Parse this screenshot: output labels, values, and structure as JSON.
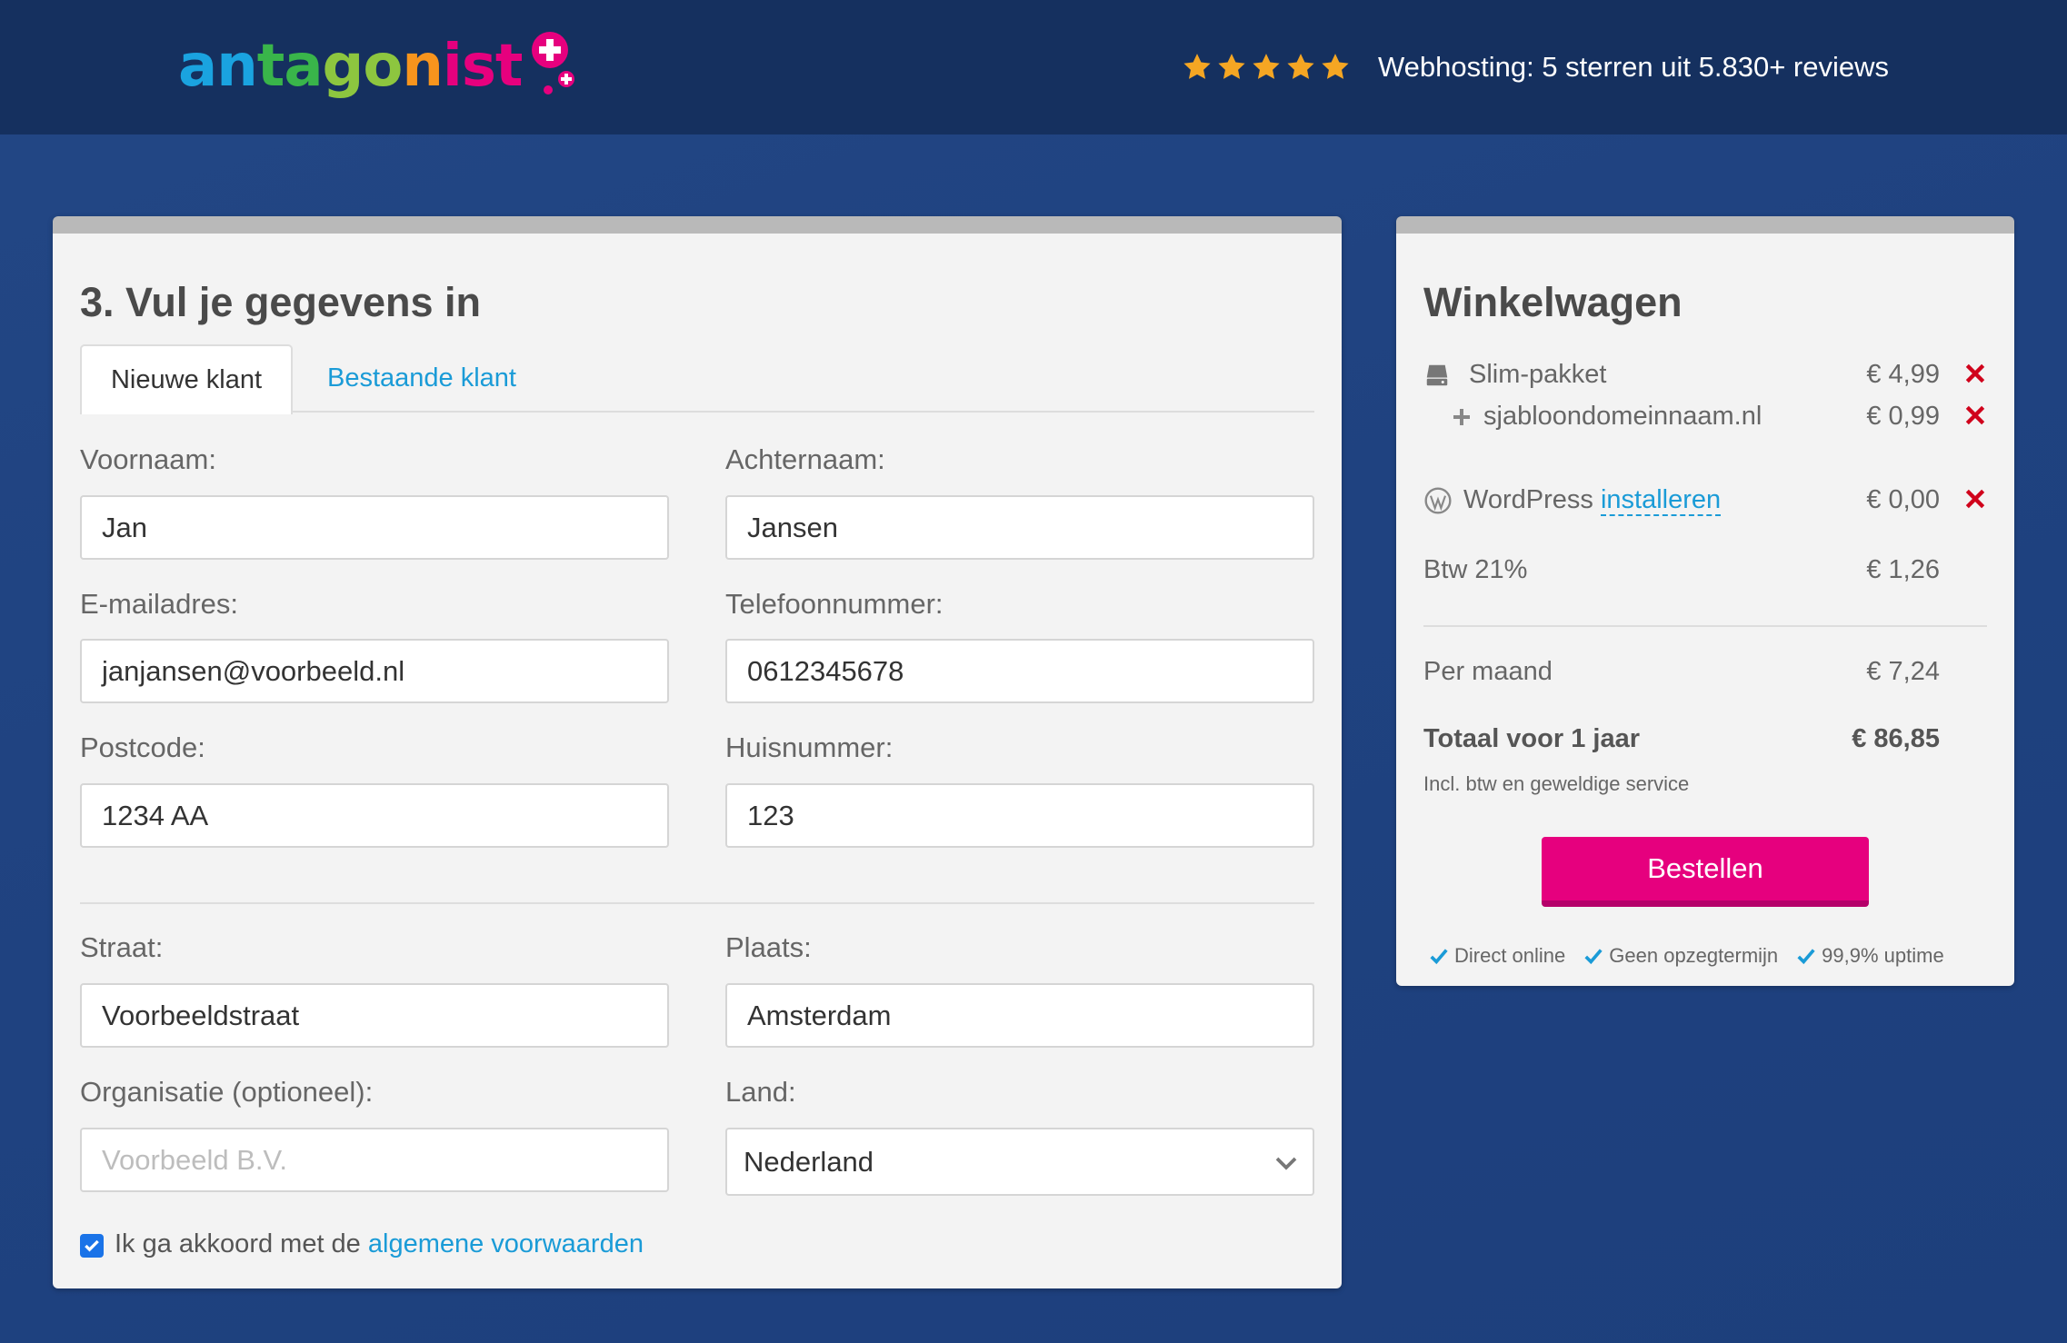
{
  "header": {
    "logo_text": "antagonist",
    "rating_text": "Webhosting: 5 sterren uit 5.830+ reviews",
    "stars": 5
  },
  "form": {
    "title": "3. Vul je gegevens in",
    "tabs": [
      {
        "label": "Nieuwe klant",
        "active": true
      },
      {
        "label": "Bestaande klant",
        "active": false
      }
    ],
    "fields": {
      "first_name": {
        "label": "Voornaam:",
        "value": "Jan"
      },
      "last_name": {
        "label": "Achternaam:",
        "value": "Jansen"
      },
      "email": {
        "label": "E-mailadres:",
        "value": "janjansen@voorbeeld.nl"
      },
      "phone": {
        "label": "Telefoonnummer:",
        "value": "0612345678"
      },
      "postcode": {
        "label": "Postcode:",
        "value": "1234 AA"
      },
      "house_number": {
        "label": "Huisnummer:",
        "value": "123"
      },
      "street": {
        "label": "Straat:",
        "value": "Voorbeeldstraat"
      },
      "city": {
        "label": "Plaats:",
        "value": "Amsterdam"
      },
      "organisation": {
        "label": "Organisatie (optioneel):",
        "placeholder": "Voorbeeld B.V."
      },
      "country": {
        "label": "Land:",
        "value": "Nederland"
      }
    },
    "agree": {
      "checked": true,
      "text": "Ik ga akkoord met de ",
      "link": "algemene voorwaarden"
    }
  },
  "cart": {
    "title": "Winkelwagen",
    "items": [
      {
        "name": "Slim-pakket",
        "price": "€ 4,99"
      },
      {
        "name": "sjabloondomeinnaam.nl",
        "price": "€ 0,99"
      },
      {
        "name": "WordPress",
        "link": "installeren",
        "price": "€ 0,00"
      }
    ],
    "vat": {
      "label": "Btw 21%",
      "price": "€ 1,26"
    },
    "per_month": {
      "label": "Per maand",
      "price": "€ 7,24"
    },
    "total": {
      "label": "Totaal voor 1 jaar",
      "price": "€ 86,85"
    },
    "note": "Incl. btw en geweldige service",
    "order_label": "Bestellen",
    "usps": [
      "Direct online",
      "Geen opzegtermijn",
      "99,9% uptime"
    ]
  },
  "colors": {
    "background": "#1f4280",
    "header": "#15305f",
    "accent_pink": "#e6007e",
    "link_blue": "#1a9bd7",
    "star": "#f5a623",
    "remove_red": "#d0021b"
  }
}
